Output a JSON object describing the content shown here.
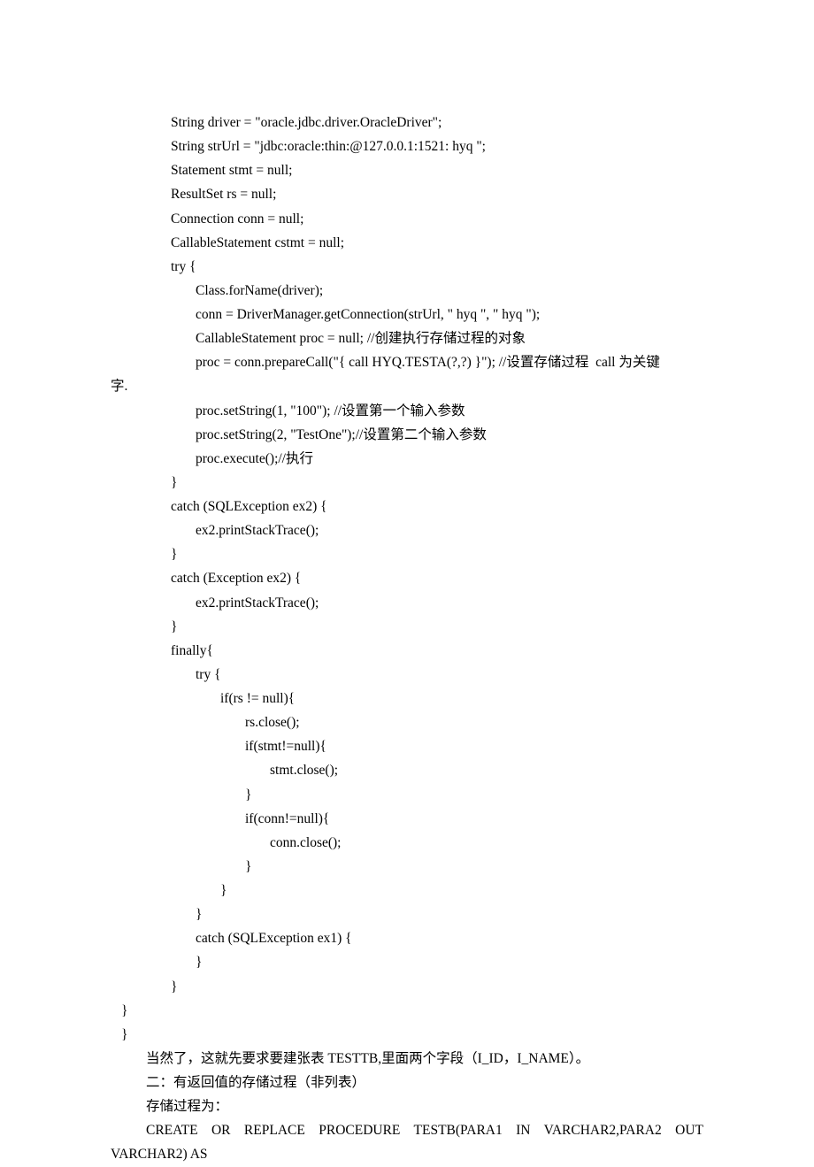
{
  "code": {
    "l1": "String driver = \"oracle.jdbc.driver.OracleDriver\";",
    "l2": "String strUrl = \"jdbc:oracle:thin:@127.0.0.1:1521: hyq \";",
    "l3": "Statement stmt = null;",
    "l4": "ResultSet rs = null;",
    "l5": "Connection conn = null;",
    "l6": "CallableStatement cstmt = null;",
    "l7": "try {",
    "l8": "Class.forName(driver);",
    "l9": "conn = DriverManager.getConnection(strUrl, \" hyq \", \" hyq \");",
    "l10": "CallableStatement proc = null; //创建执行存储过程的对象",
    "l11a": "proc = conn.prepareCall(\"{ call HYQ.TESTA(?,?) }\"); //设置存储过程  call 为关键",
    "l11b": "字.",
    "l12": "proc.setString(1, \"100\"); //设置第一个输入参数",
    "l13": "proc.setString(2, \"TestOne\");//设置第二个输入参数",
    "l14": "proc.execute();//执行",
    "l15": "}",
    "l16": "catch (SQLException ex2) {",
    "l17": "ex2.printStackTrace();",
    "l18": "}",
    "l19": "catch (Exception ex2) {",
    "l20": "ex2.printStackTrace();",
    "l21": "}",
    "l22": "finally{",
    "l23": "try {",
    "l24": "if(rs != null){",
    "l25": "rs.close();",
    "l26": "if(stmt!=null){",
    "l27": "stmt.close();",
    "l28": "}",
    "l29": "if(conn!=null){",
    "l30": "conn.close();",
    "l31": "}",
    "l32": "}",
    "l33": "}",
    "l34": "catch (SQLException ex1) {",
    "l35": "}",
    "l36": "}",
    "l37": "}",
    "l38": "}"
  },
  "para": {
    "p1": "当然了，这就先要求要建张表 TESTTB,里面两个字段（I_ID，I_NAME）。",
    "p2": "二：有返回值的存储过程（非列表）",
    "p3": "存储过程为：",
    "p4a": "CREATE  OR  REPLACE  PROCEDURE  TESTB(PARA1  IN  VARCHAR2,PARA2  OUT",
    "p4b": "VARCHAR2) AS"
  }
}
